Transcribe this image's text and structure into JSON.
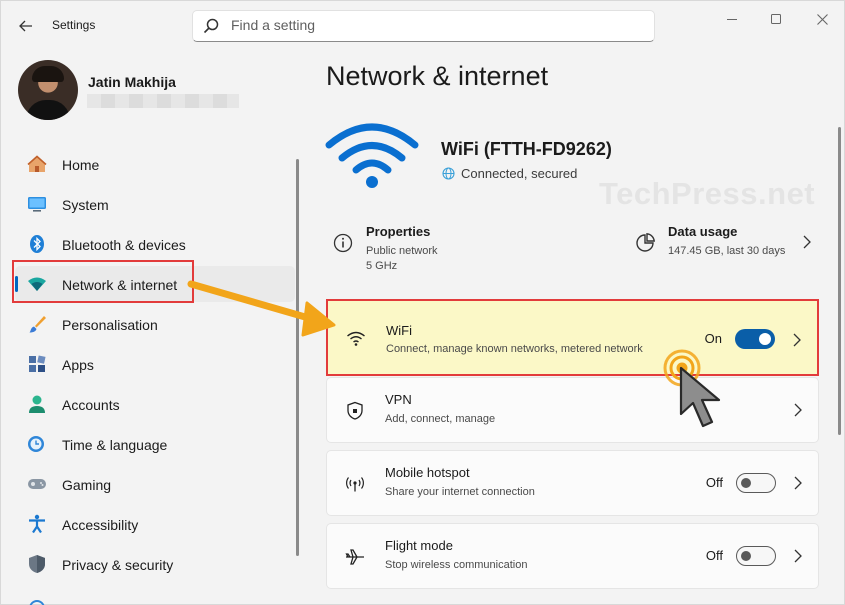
{
  "window": {
    "title": "Settings",
    "controls": [
      "minimize",
      "maximize",
      "close"
    ]
  },
  "search": {
    "placeholder": "Find a setting",
    "value": ""
  },
  "profile": {
    "name": "Jatin Makhija",
    "email": ""
  },
  "sidebar": {
    "items": [
      {
        "label": "Home",
        "icon": "home-icon"
      },
      {
        "label": "System",
        "icon": "system-icon"
      },
      {
        "label": "Bluetooth & devices",
        "icon": "bluetooth-icon"
      },
      {
        "label": "Network & internet",
        "icon": "network-icon",
        "active": true
      },
      {
        "label": "Personalisation",
        "icon": "brush-icon"
      },
      {
        "label": "Apps",
        "icon": "apps-icon"
      },
      {
        "label": "Accounts",
        "icon": "accounts-icon"
      },
      {
        "label": "Time & language",
        "icon": "time-language-icon"
      },
      {
        "label": "Gaming",
        "icon": "gaming-icon"
      },
      {
        "label": "Accessibility",
        "icon": "accessibility-icon"
      },
      {
        "label": "Privacy & security",
        "icon": "shield-icon"
      }
    ]
  },
  "main": {
    "title": "Network & internet",
    "connection": {
      "name": "WiFi (FTTH-FD9262)",
      "status": "Connected, secured"
    },
    "properties": {
      "title": "Properties",
      "line1": "Public network",
      "line2": "5 GHz"
    },
    "data_usage": {
      "title": "Data usage",
      "detail": "147.45 GB, last 30 days"
    },
    "cards": [
      {
        "title": "WiFi",
        "subtitle": "Connect, manage known networks, metered network",
        "state": "On",
        "icon": "wifi-icon"
      },
      {
        "title": "VPN",
        "subtitle": "Add, connect, manage",
        "state": "",
        "icon": "vpn-shield-icon"
      },
      {
        "title": "Mobile hotspot",
        "subtitle": "Share your internet connection",
        "state": "Off",
        "icon": "hotspot-icon"
      },
      {
        "title": "Flight mode",
        "subtitle": "Stop wireless communication",
        "state": "Off",
        "icon": "airplane-icon"
      }
    ]
  },
  "watermark": "TechPress.net",
  "colors": {
    "accent": "#0067c0",
    "toggle_on": "#0a5ea8",
    "highlight_bg": "#fbf8c7",
    "highlight_border": "#e23b3b",
    "arrow": "#f2a51a"
  }
}
